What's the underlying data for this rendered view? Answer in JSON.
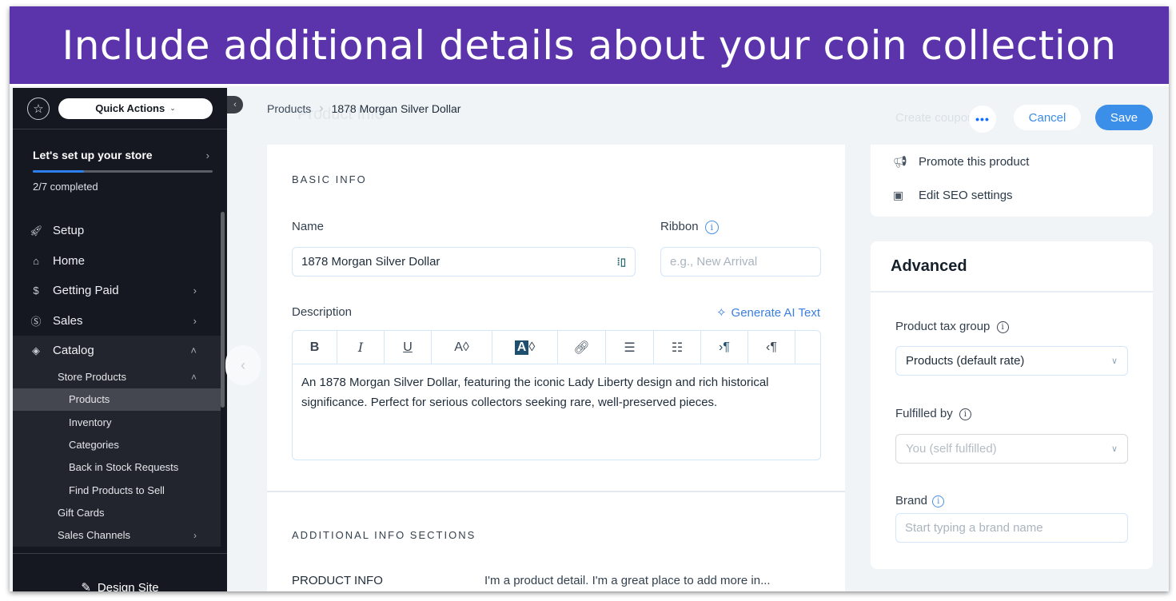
{
  "banner": {
    "title": "Include additional details about your coin collection",
    "bg_color": "#5b33ab"
  },
  "sidebar": {
    "quick_actions": "Quick Actions",
    "setup": {
      "title": "Let's set up your store",
      "progress_label": "2/7 completed",
      "completed": 2,
      "total": 7
    },
    "nav": [
      {
        "label": "Setup",
        "icon": "rocket-icon"
      },
      {
        "label": "Home",
        "icon": "home-icon"
      },
      {
        "label": "Getting Paid",
        "icon": "payment-icon",
        "has_chevron": true
      },
      {
        "label": "Sales",
        "icon": "dollar-icon",
        "has_chevron": true
      },
      {
        "label": "Catalog",
        "icon": "catalog-icon",
        "expanded": true
      }
    ],
    "catalog_sub": {
      "store_products": "Store Products",
      "store_products_items": [
        "Products",
        "Inventory",
        "Categories",
        "Back in Stock Requests",
        "Find Products to Sell"
      ],
      "active": "Products",
      "gift_cards": "Gift Cards",
      "sales_channels": "Sales Channels"
    },
    "design_site": "Design Site"
  },
  "header": {
    "breadcrumb": {
      "parent": "Products",
      "current": "1878 Morgan Silver Dollar"
    },
    "ghost_title": "Product Info",
    "ghost_action": "Create coupon",
    "more_label": "•••",
    "cancel_label": "Cancel",
    "save_label": "Save"
  },
  "basic_info": {
    "section_title": "BASIC INFO",
    "name_label": "Name",
    "name_value": "1878 Morgan Silver Dollar",
    "ribbon_label": "Ribbon",
    "ribbon_placeholder": "e.g., New Arrival",
    "description_label": "Description",
    "generate_ai_label": "Generate AI Text",
    "toolbar": [
      "bold",
      "italic",
      "underline",
      "text-color",
      "highlight-color",
      "link",
      "bullet-list",
      "numbered-list",
      "ltr",
      "rtl"
    ],
    "description_value": "An 1878 Morgan Silver Dollar, featuring the iconic Lady Liberty design and rich historical significance. Perfect for serious collectors seeking rare, well-preserved pieces."
  },
  "additional_info": {
    "section_title": "ADDITIONAL INFO SECTIONS",
    "rows": [
      {
        "title": "PRODUCT INFO",
        "preview": "I'm a product detail. I'm a great place to add more in..."
      }
    ]
  },
  "right_panel": {
    "actions": [
      {
        "label": "Promote this product",
        "icon": "megaphone-icon"
      },
      {
        "label": "Edit SEO settings",
        "icon": "seo-icon"
      }
    ],
    "advanced": {
      "title": "Advanced",
      "tax_group_label": "Product tax group",
      "tax_group_value": "Products (default rate)",
      "fulfilled_label": "Fulfilled by",
      "fulfilled_value": "You (self fulfilled)",
      "brand_label": "Brand",
      "brand_placeholder": "Start typing a brand name"
    }
  }
}
